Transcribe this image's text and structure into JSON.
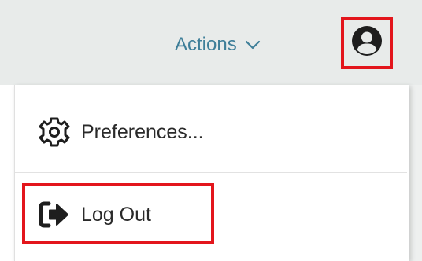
{
  "header": {
    "actions_label": "Actions",
    "actions_icon": "chevron-down-icon",
    "user_icon": "user-circle-icon"
  },
  "menu": {
    "items": [
      {
        "label": "Preferences...",
        "icon": "gear-icon"
      },
      {
        "label": "Log Out",
        "icon": "sign-out-icon"
      }
    ]
  },
  "colors": {
    "header_bg": "#e8ebea",
    "actions_text": "#3f7f99",
    "highlight": "#e3161c",
    "menu_text": "#2a2a2a",
    "icon_dark": "#1e1e1e"
  }
}
